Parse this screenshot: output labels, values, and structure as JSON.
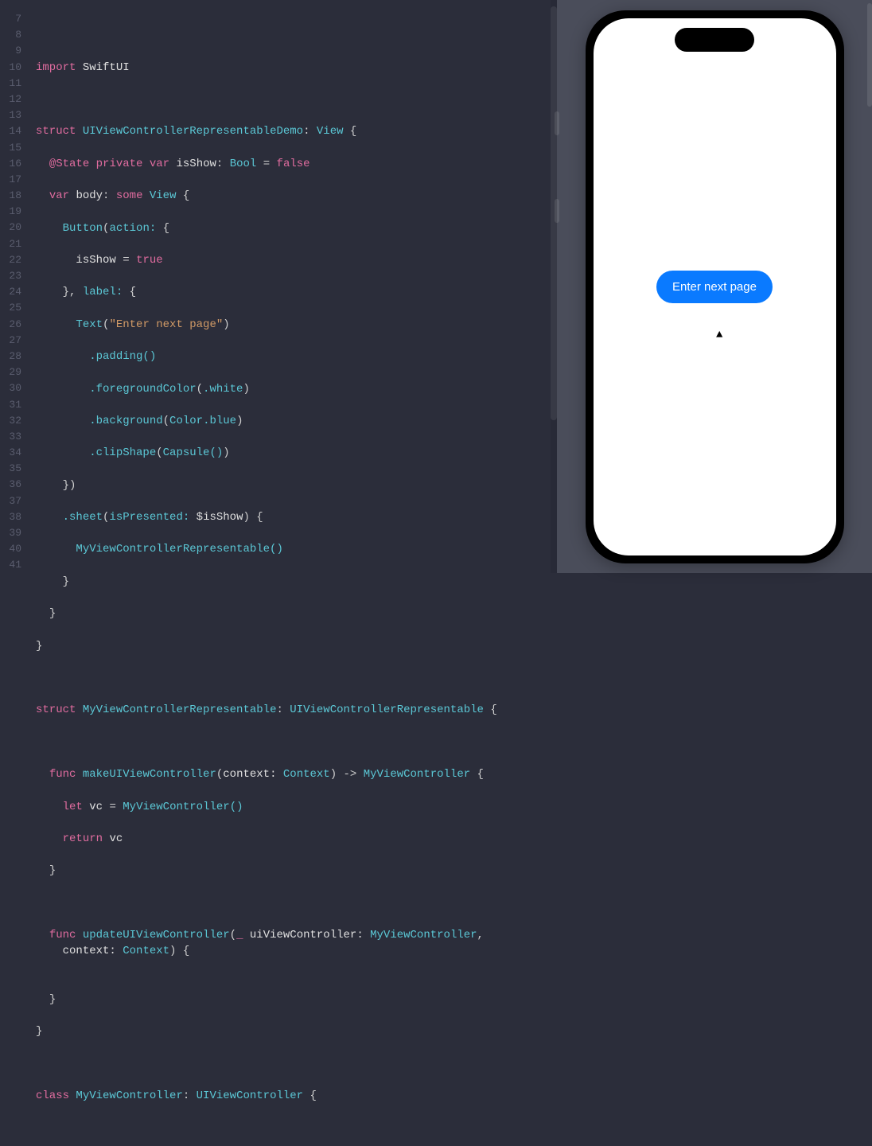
{
  "editor": {
    "firstLine": 7,
    "lastLine": 41,
    "lines": {
      "l8": {
        "kw": "import",
        "mod": "SwiftUI"
      },
      "l10": {
        "kw": "struct",
        "name": "UIViewControllerRepresentableDemo",
        "proto": "View"
      },
      "l11": {
        "at": "@State",
        "priv": "private",
        "var": "var",
        "name": "isShow",
        "type": "Bool",
        "eq": "=",
        "val": "false"
      },
      "l12": {
        "var": "var",
        "name": "body",
        "some": "some",
        "type": "View"
      },
      "l13": {
        "fn": "Button",
        "arg": "action:"
      },
      "l14": {
        "name": "isShow",
        "eq": "=",
        "val": "true"
      },
      "l15": {
        "lbl": "label:"
      },
      "l16": {
        "fn": "Text",
        "str": "\"Enter next page\""
      },
      "l17": {
        "mod": ".padding()"
      },
      "l18": {
        "mod": ".foregroundColor",
        "arg": ".white"
      },
      "l19": {
        "mod": ".background",
        "arg1": "Color",
        "arg2": ".blue"
      },
      "l20": {
        "mod": ".clipShape",
        "arg": "Capsule()"
      },
      "l22": {
        "mod": ".sheet",
        "arg": "isPresented:",
        "val": "$isShow"
      },
      "l23": {
        "fn": "MyViewControllerRepresentable()"
      },
      "l28": {
        "kw": "struct",
        "name": "MyViewControllerRepresentable",
        "proto": "UIViewControllerRepresentable"
      },
      "l30": {
        "kw": "func",
        "name": "makeUIViewController",
        "arg": "context:",
        "type": "Context",
        "ret": "MyViewController"
      },
      "l31": {
        "kw": "let",
        "name": "vc",
        "eq": "=",
        "val": "MyViewController()"
      },
      "l32": {
        "kw": "return",
        "name": "vc"
      },
      "l35": {
        "kw": "func",
        "name": "updateUIViewController",
        "us": "_",
        "arg1": "uiViewController:",
        "type1": "MyViewController",
        "arg2": "context:",
        "type2": "Context"
      },
      "l40": {
        "kw": "class",
        "name": "MyViewController",
        "proto": "UIViewController"
      }
    }
  },
  "preview": {
    "buttonLabel": "Enter next page"
  }
}
